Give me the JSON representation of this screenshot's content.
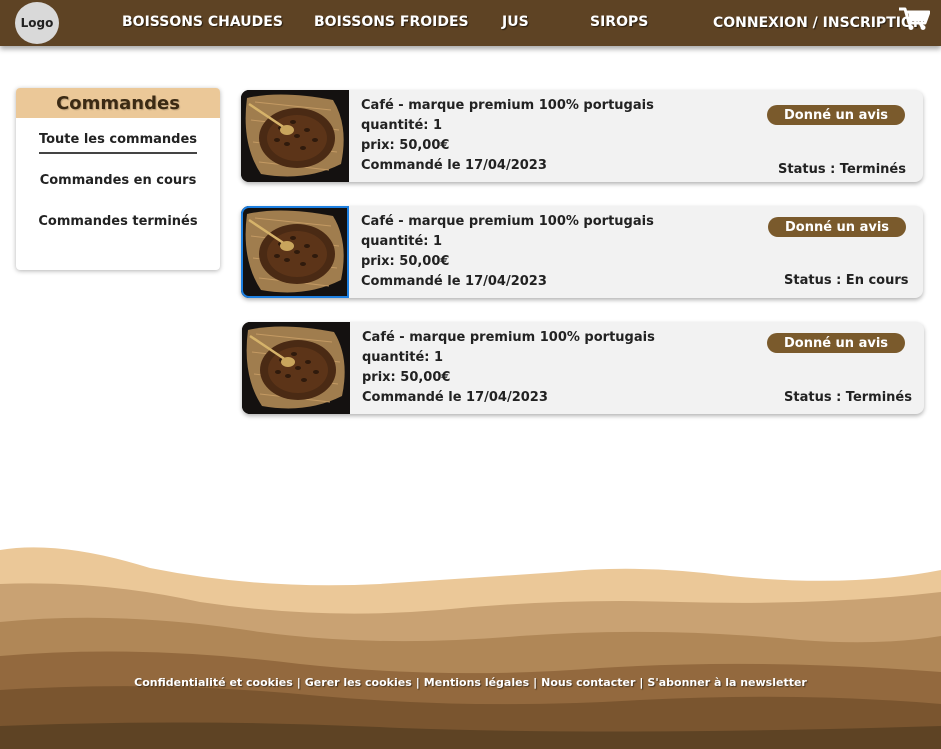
{
  "header": {
    "logo": "Logo",
    "nav": [
      "BOISSONS CHAUDES",
      "BOISSONS FROIDES",
      "JUS",
      "SIROPS"
    ],
    "login": "CONNEXION / INSCRIPTION",
    "cart_icon": "shopping-cart-icon"
  },
  "sidebar": {
    "title": "Commandes",
    "items": [
      {
        "label": "Toute les commandes",
        "active": true
      },
      {
        "label": "Commandes en cours",
        "active": false
      },
      {
        "label": "Commandes terminés",
        "active": false
      }
    ]
  },
  "orders": [
    {
      "title": "Café - marque premium 100% portugais",
      "quantity": "quantité: 1",
      "price": "prix:  50,00€",
      "date": "Commandé le 17/04/2023",
      "review": "Donné un avis",
      "status": "Status : Terminés"
    },
    {
      "title": "Café - marque premium 100% portugais",
      "quantity": "quantité: 1",
      "price": "prix:  50,00€",
      "date": "Commandé le 17/04/2023",
      "review": "Donné un avis",
      "status": "Status : En cours"
    },
    {
      "title": "Café - marque premium 100% portugais",
      "quantity": "quantité: 1",
      "price": "prix:  50,00€",
      "date": "Commandé le 17/04/2023",
      "review": "Donné un avis",
      "status": "Status : Terminés"
    }
  ],
  "footer": {
    "links": [
      "Confidentialité et cookies",
      "Gerer les cookies",
      "Mentions légales",
      "Nous contacter",
      "S'abonner à la newsletter"
    ],
    "separator": "|"
  },
  "colors": {
    "brand_brown": "#5e4324",
    "sidebar_header": "#ebc898",
    "review_button": "#7a5a2c",
    "card_bg": "#f2f2f2",
    "selected_outline": "#1d7fe0"
  }
}
